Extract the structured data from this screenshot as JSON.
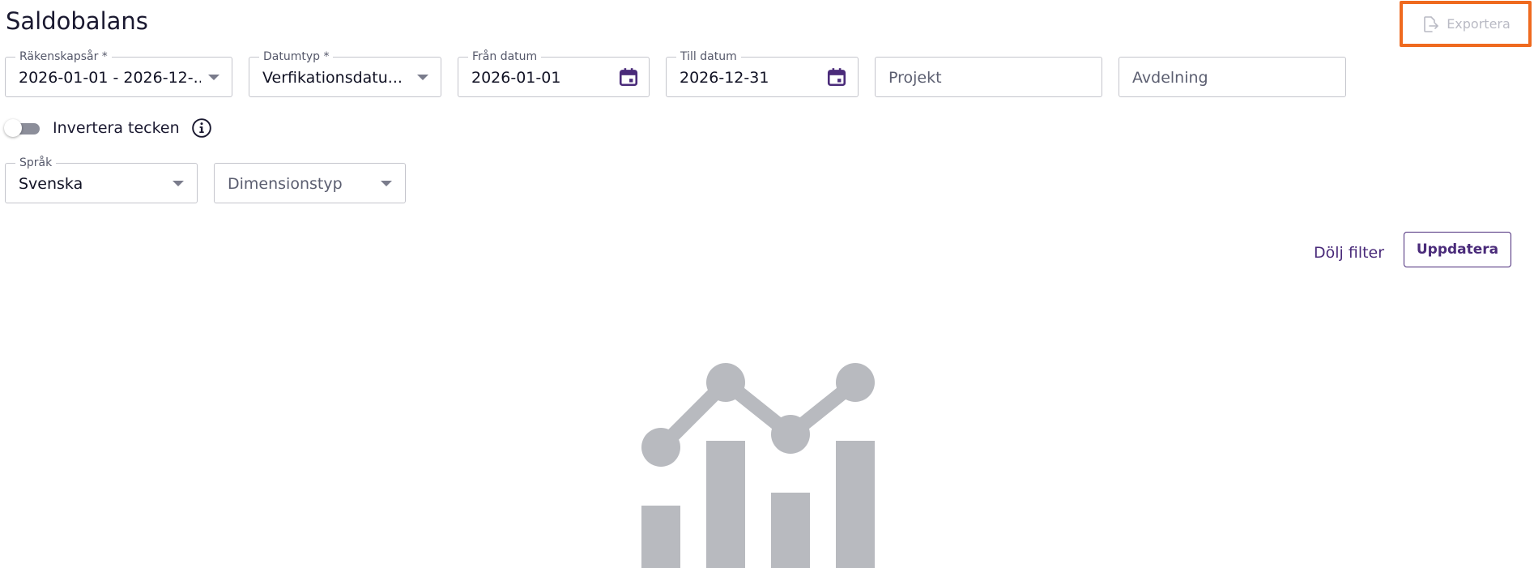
{
  "page": {
    "title": "Saldobalans"
  },
  "toolbar": {
    "export_label": "Exportera",
    "export_icon": "export-icon",
    "highlight_color": "#ef6a1f"
  },
  "filters": {
    "fiscal_year": {
      "label": "Räkenskapsår *",
      "value": "2026-01-01 - 2026-12-..."
    },
    "date_type": {
      "label": "Datumtyp *",
      "value": "Verfikationsdatu..."
    },
    "from_date": {
      "label": "Från datum",
      "value": "2026-01-01"
    },
    "to_date": {
      "label": "Till datum",
      "value": "2026-12-31"
    },
    "project": {
      "placeholder": "Projekt"
    },
    "department": {
      "placeholder": "Avdelning"
    },
    "invert_sign": {
      "label": "Invertera tecken",
      "checked": false
    },
    "language": {
      "label": "Språk",
      "value": "Svenska"
    },
    "dimension_type": {
      "placeholder": "Dimensionstyp"
    }
  },
  "actions": {
    "hide_filter_label": "Dölj filter",
    "update_label": "Uppdatera"
  },
  "colors": {
    "accent": "#4a2b7a",
    "illustration": "#b8babf"
  }
}
